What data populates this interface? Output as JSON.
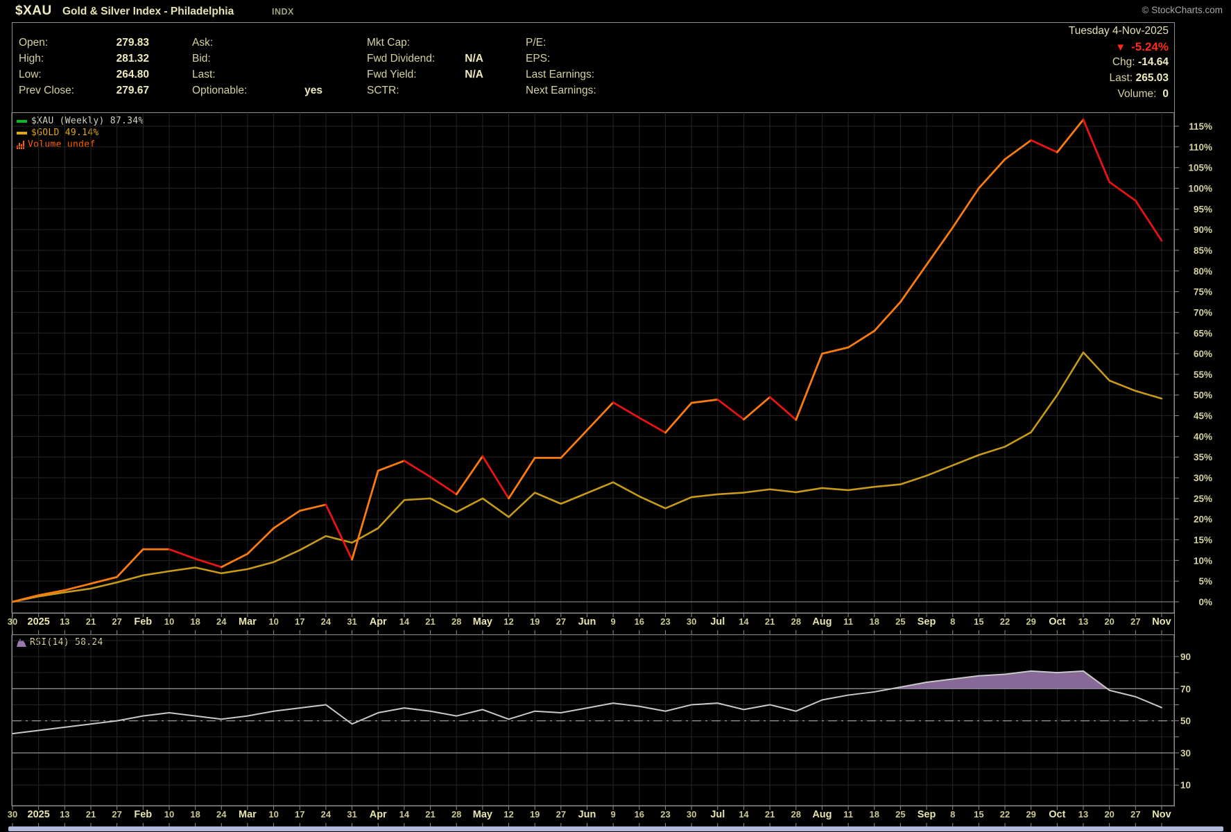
{
  "header": {
    "symbol": "$XAU",
    "title": "Gold & Silver Index - Philadelphia",
    "exchange": "INDX",
    "copyright": "© StockCharts.com"
  },
  "quote": {
    "col1": [
      {
        "label": "Open:",
        "value": "279.83"
      },
      {
        "label": "High:",
        "value": "281.32"
      },
      {
        "label": "Low:",
        "value": "264.80"
      },
      {
        "label": "Prev Close:",
        "value": "279.67"
      }
    ],
    "col2": [
      {
        "label": "Ask:",
        "value": ""
      },
      {
        "label": "Bid:",
        "value": ""
      },
      {
        "label": "Last:",
        "value": ""
      },
      {
        "label": "Optionable:",
        "value": "yes"
      }
    ],
    "col3": [
      {
        "label": "Mkt Cap:",
        "value": ""
      },
      {
        "label": "Fwd Dividend:",
        "value": "N/A"
      },
      {
        "label": "Fwd Yield:",
        "value": "N/A"
      },
      {
        "label": "SCTR:",
        "value": ""
      }
    ],
    "col4": [
      {
        "label": "P/E:",
        "value": ""
      },
      {
        "label": "EPS:",
        "value": ""
      },
      {
        "label": "Last Earnings:",
        "value": ""
      },
      {
        "label": "Next Earnings:",
        "value": ""
      }
    ],
    "date": "Tuesday 4-Nov-2025",
    "pct_arrow": "▼",
    "pct_change": "-5.24%",
    "chg_label": "Chg:",
    "chg_value": "-14.64",
    "last_label": "Last:",
    "last_value": "265.03",
    "volume_label": "Volume:",
    "volume_value": "0"
  },
  "legend": [
    {
      "name": "$XAU (Weekly) 87.34%",
      "swatch_color": "#00bb22",
      "text_color": "#d4d2c2",
      "type": "line"
    },
    {
      "name": "$GOLD 49.14%",
      "swatch_color": "#e0a810",
      "text_color": "#e0a810",
      "type": "line"
    },
    {
      "name": "Volume undef",
      "swatch_color": "#ff5f00",
      "text_color": "#ff5f00",
      "type": "bars"
    }
  ],
  "rsi_legend": {
    "label": "RSI(14) 58.24",
    "icon_color": "#9b79ae"
  },
  "chart_data": [
    {
      "type": "line",
      "title": "$XAU (Weekly) vs $GOLD - cumulative percent change, Dec 2024 - Nov 2025",
      "x_labels": [
        "30",
        "2025",
        "13",
        "21",
        "27",
        "Feb",
        "10",
        "18",
        "24",
        "Mar",
        "10",
        "17",
        "24",
        "31",
        "Apr",
        "14",
        "21",
        "28",
        "May",
        "12",
        "19",
        "27",
        "Jun",
        "9",
        "16",
        "23",
        "30",
        "Jul",
        "14",
        "21",
        "28",
        "Aug",
        "11",
        "18",
        "25",
        "Sep",
        "8",
        "15",
        "22",
        "29",
        "Oct",
        "13",
        "20",
        "27",
        "Nov"
      ],
      "emphasized_x_labels": [
        "2025",
        "Feb",
        "Mar",
        "Apr",
        "May",
        "Jun",
        "Jul",
        "Aug",
        "Sep",
        "Oct",
        "Nov"
      ],
      "ylim": [
        0,
        118
      ],
      "y_step": 5,
      "y_tick_labels": [
        "0%",
        "5%",
        "10%",
        "15%",
        "20%",
        "25%",
        "30%",
        "35%",
        "40%",
        "45%",
        "50%",
        "55%",
        "60%",
        "65%",
        "70%",
        "75%",
        "80%",
        "85%",
        "90%",
        "95%",
        "100%",
        "105%",
        "110%",
        "115%"
      ],
      "grid": true,
      "legend_position": "top-left",
      "zero_line_color": "#7a7a7a",
      "grid_color": "#262626",
      "series": [
        {
          "name": "$XAU (Weekly)",
          "last_label": "87.34%",
          "style": "two-tone",
          "color_up": "#fb7b0f",
          "color_down": "#e81414",
          "values": [
            0,
            1.6,
            2.8,
            4.4,
            6.0,
            12.7,
            12.7,
            10.4,
            8.4,
            11.6,
            17.8,
            22.0,
            23.5,
            10.2,
            31.7,
            34.1,
            30.2,
            26.0,
            35.2,
            25.0,
            34.8,
            34.8,
            41.5,
            48.2,
            44.5,
            40.9,
            48.1,
            48.9,
            44.1,
            49.5,
            44.0,
            60.0,
            61.5,
            65.5,
            72.5,
            81.5,
            90.5,
            100.0,
            107.0,
            111.6,
            108.7,
            116.6,
            101.5,
            97.0,
            87.34
          ]
        },
        {
          "name": "$GOLD",
          "last_label": "49.14%",
          "style": "solid",
          "color": "#c79a18",
          "values": [
            0,
            1.3,
            2.3,
            3.2,
            4.7,
            6.4,
            7.4,
            8.3,
            6.9,
            7.9,
            9.6,
            12.5,
            15.9,
            14.3,
            17.8,
            24.6,
            25.0,
            21.7,
            25.0,
            20.5,
            26.4,
            23.7,
            26.3,
            28.9,
            25.5,
            22.6,
            25.3,
            26.0,
            26.4,
            27.2,
            26.5,
            27.5,
            27.0,
            27.8,
            28.4,
            30.5,
            33.0,
            35.5,
            37.5,
            41.0,
            50.0,
            60.3,
            53.5,
            51.0,
            49.14
          ]
        }
      ]
    },
    {
      "type": "area",
      "name": "RSI(14)",
      "last_value": 58.24,
      "ylim": [
        0,
        100
      ],
      "y_ticks": [
        10,
        20,
        30,
        40,
        50,
        60,
        70,
        80,
        90
      ],
      "y_tick_labels": [
        "10",
        "30",
        "50",
        "70",
        "90"
      ],
      "hlines_solid": [
        70,
        30
      ],
      "hlines_dashdot": [
        50
      ],
      "fill_above": 70,
      "fill_color": "#8e6e9e",
      "line_color": "#c9c9c9",
      "hline_color": "#8a8a8a",
      "grid_color": "#262626",
      "values": [
        42,
        44,
        46,
        48,
        50,
        53,
        55,
        53,
        51,
        53,
        56,
        58,
        60,
        48,
        55,
        58,
        56,
        53,
        57,
        51,
        56,
        55,
        58,
        61,
        59,
        56,
        60,
        61,
        57,
        60,
        56,
        63,
        66,
        68,
        71,
        74,
        76,
        78,
        79,
        81,
        80,
        81,
        69,
        65,
        58.24
      ]
    }
  ]
}
